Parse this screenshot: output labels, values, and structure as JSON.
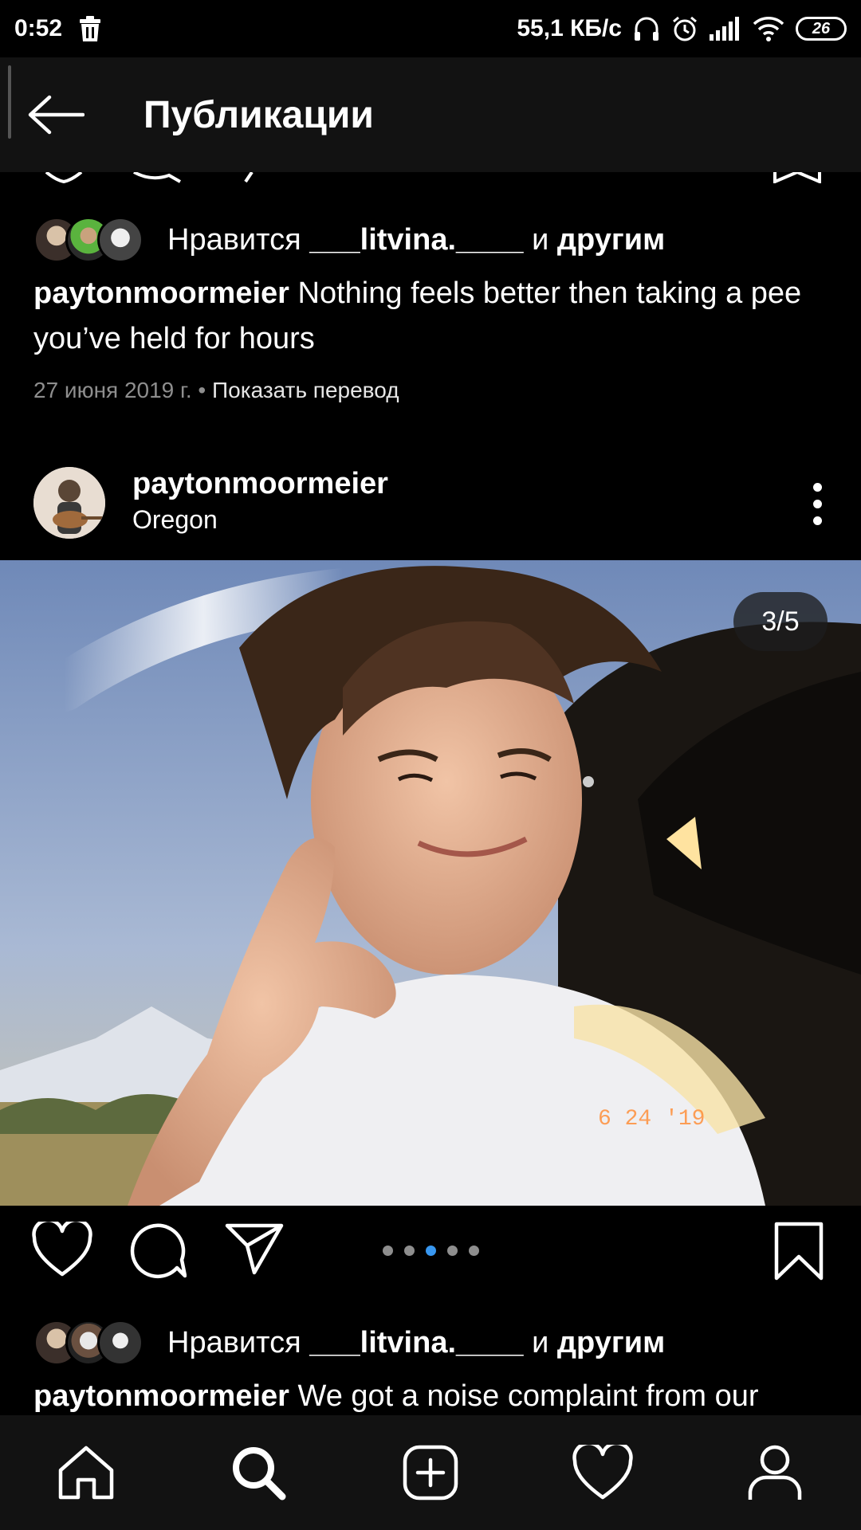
{
  "status_bar": {
    "time": "0:52",
    "network_speed": "55,1 КБ/с",
    "battery": "26",
    "icons": [
      "trash-icon",
      "headphones-icon",
      "alarm-icon",
      "signal-icon",
      "wifi-icon",
      "battery-icon"
    ]
  },
  "header": {
    "title": "Публикации",
    "back_icon": "arrow-left-icon"
  },
  "post_top": {
    "likes": {
      "prefix": "Нравится",
      "user": "___litvina.____",
      "conj": "и",
      "others": "другим"
    },
    "caption": {
      "username": "paytonmoormeier",
      "text": "Nothing feels better then taking a pee you’ve held for hours"
    },
    "date": "27 июня 2019 г.",
    "separator": "•",
    "translate": "Показать перевод"
  },
  "post_main": {
    "username": "paytonmoormeier",
    "location": "Oregon",
    "counter": "3/5",
    "image_stamp": "6 24 '19",
    "carousel": {
      "total": 5,
      "active_index": 2
    },
    "likes": {
      "prefix": "Нравится",
      "user": "___litvina.____",
      "conj": "и",
      "others": "другим"
    },
    "caption": {
      "username": "paytonmoormeier",
      "text": "We got a noise complaint from our"
    }
  },
  "bottom_nav": {
    "items": [
      "home-icon",
      "search-icon",
      "add-post-icon",
      "activity-heart-icon",
      "profile-icon"
    ]
  },
  "colors": {
    "background": "#000000",
    "bars": "#121212",
    "muted_text": "#8e8e8e",
    "active_dot": "#3897f0"
  }
}
